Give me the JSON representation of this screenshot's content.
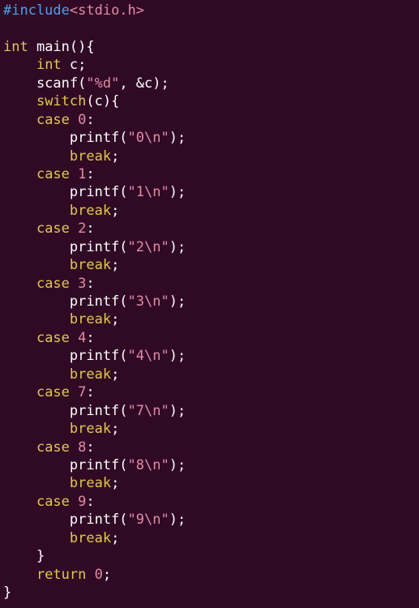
{
  "editor": {
    "background": "#300a24",
    "colors": {
      "preproc": "#4fa0e6",
      "type": "#dcca5a",
      "keyword": "#e2c84f",
      "string": "#e58aa8",
      "number": "#e58aa8",
      "default": "#ffffff"
    },
    "lines": [
      {
        "tokens": [
          {
            "text": "#include",
            "color": "#4fa0e6"
          },
          {
            "text": "<stdio.h>",
            "color": "#e58aa8"
          }
        ]
      },
      {
        "tokens": []
      },
      {
        "tokens": [
          {
            "text": "int",
            "color": "#dcca5a"
          },
          {
            "text": " main(){",
            "color": "#ffffff"
          }
        ]
      },
      {
        "tokens": [
          {
            "text": "    ",
            "color": "#ffffff"
          },
          {
            "text": "int",
            "color": "#dcca5a"
          },
          {
            "text": " c;",
            "color": "#ffffff"
          }
        ]
      },
      {
        "tokens": [
          {
            "text": "    scanf(",
            "color": "#ffffff"
          },
          {
            "text": "\"%d\"",
            "color": "#e58aa8"
          },
          {
            "text": ", &c);",
            "color": "#ffffff"
          }
        ]
      },
      {
        "tokens": [
          {
            "text": "    ",
            "color": "#ffffff"
          },
          {
            "text": "switch",
            "color": "#e2c84f"
          },
          {
            "text": "(c){",
            "color": "#ffffff"
          }
        ]
      },
      {
        "tokens": [
          {
            "text": "    ",
            "color": "#ffffff"
          },
          {
            "text": "case",
            "color": "#e2c84f"
          },
          {
            "text": " ",
            "color": "#ffffff"
          },
          {
            "text": "0",
            "color": "#e58aa8"
          },
          {
            "text": ":",
            "color": "#ffffff"
          }
        ]
      },
      {
        "tokens": [
          {
            "text": "        printf(",
            "color": "#ffffff"
          },
          {
            "text": "\"0\\n\"",
            "color": "#e58aa8"
          },
          {
            "text": ");",
            "color": "#ffffff"
          }
        ]
      },
      {
        "tokens": [
          {
            "text": "        ",
            "color": "#ffffff"
          },
          {
            "text": "break",
            "color": "#e2c84f"
          },
          {
            "text": ";",
            "color": "#ffffff"
          }
        ]
      },
      {
        "tokens": [
          {
            "text": "    ",
            "color": "#ffffff"
          },
          {
            "text": "case",
            "color": "#e2c84f"
          },
          {
            "text": " ",
            "color": "#ffffff"
          },
          {
            "text": "1",
            "color": "#e58aa8"
          },
          {
            "text": ":",
            "color": "#ffffff"
          }
        ]
      },
      {
        "tokens": [
          {
            "text": "        printf(",
            "color": "#ffffff"
          },
          {
            "text": "\"1\\n\"",
            "color": "#e58aa8"
          },
          {
            "text": ");",
            "color": "#ffffff"
          }
        ]
      },
      {
        "tokens": [
          {
            "text": "        ",
            "color": "#ffffff"
          },
          {
            "text": "break",
            "color": "#e2c84f"
          },
          {
            "text": ";",
            "color": "#ffffff"
          }
        ]
      },
      {
        "tokens": [
          {
            "text": "    ",
            "color": "#ffffff"
          },
          {
            "text": "case",
            "color": "#e2c84f"
          },
          {
            "text": " ",
            "color": "#ffffff"
          },
          {
            "text": "2",
            "color": "#e58aa8"
          },
          {
            "text": ":",
            "color": "#ffffff"
          }
        ]
      },
      {
        "tokens": [
          {
            "text": "        printf(",
            "color": "#ffffff"
          },
          {
            "text": "\"2\\n\"",
            "color": "#e58aa8"
          },
          {
            "text": ");",
            "color": "#ffffff"
          }
        ]
      },
      {
        "tokens": [
          {
            "text": "        ",
            "color": "#ffffff"
          },
          {
            "text": "break",
            "color": "#e2c84f"
          },
          {
            "text": ";",
            "color": "#ffffff"
          }
        ]
      },
      {
        "tokens": [
          {
            "text": "    ",
            "color": "#ffffff"
          },
          {
            "text": "case",
            "color": "#e2c84f"
          },
          {
            "text": " ",
            "color": "#ffffff"
          },
          {
            "text": "3",
            "color": "#e58aa8"
          },
          {
            "text": ":",
            "color": "#ffffff"
          }
        ]
      },
      {
        "tokens": [
          {
            "text": "        printf(",
            "color": "#ffffff"
          },
          {
            "text": "\"3\\n\"",
            "color": "#e58aa8"
          },
          {
            "text": ");",
            "color": "#ffffff"
          }
        ]
      },
      {
        "tokens": [
          {
            "text": "        ",
            "color": "#ffffff"
          },
          {
            "text": "break",
            "color": "#e2c84f"
          },
          {
            "text": ";",
            "color": "#ffffff"
          }
        ]
      },
      {
        "tokens": [
          {
            "text": "    ",
            "color": "#ffffff"
          },
          {
            "text": "case",
            "color": "#e2c84f"
          },
          {
            "text": " ",
            "color": "#ffffff"
          },
          {
            "text": "4",
            "color": "#e58aa8"
          },
          {
            "text": ":",
            "color": "#ffffff"
          }
        ]
      },
      {
        "tokens": [
          {
            "text": "        printf(",
            "color": "#ffffff"
          },
          {
            "text": "\"4\\n\"",
            "color": "#e58aa8"
          },
          {
            "text": ");",
            "color": "#ffffff"
          }
        ]
      },
      {
        "tokens": [
          {
            "text": "        ",
            "color": "#ffffff"
          },
          {
            "text": "break",
            "color": "#e2c84f"
          },
          {
            "text": ";",
            "color": "#ffffff"
          }
        ]
      },
      {
        "tokens": [
          {
            "text": "    ",
            "color": "#ffffff"
          },
          {
            "text": "case",
            "color": "#e2c84f"
          },
          {
            "text": " ",
            "color": "#ffffff"
          },
          {
            "text": "7",
            "color": "#e58aa8"
          },
          {
            "text": ":",
            "color": "#ffffff"
          }
        ]
      },
      {
        "tokens": [
          {
            "text": "        printf(",
            "color": "#ffffff"
          },
          {
            "text": "\"7\\n\"",
            "color": "#e58aa8"
          },
          {
            "text": ");",
            "color": "#ffffff"
          }
        ]
      },
      {
        "tokens": [
          {
            "text": "        ",
            "color": "#ffffff"
          },
          {
            "text": "break",
            "color": "#e2c84f"
          },
          {
            "text": ";",
            "color": "#ffffff"
          }
        ]
      },
      {
        "tokens": [
          {
            "text": "    ",
            "color": "#ffffff"
          },
          {
            "text": "case",
            "color": "#e2c84f"
          },
          {
            "text": " ",
            "color": "#ffffff"
          },
          {
            "text": "8",
            "color": "#e58aa8"
          },
          {
            "text": ":",
            "color": "#ffffff"
          }
        ]
      },
      {
        "tokens": [
          {
            "text": "        printf(",
            "color": "#ffffff"
          },
          {
            "text": "\"8\\n\"",
            "color": "#e58aa8"
          },
          {
            "text": ");",
            "color": "#ffffff"
          }
        ]
      },
      {
        "tokens": [
          {
            "text": "        ",
            "color": "#ffffff"
          },
          {
            "text": "break",
            "color": "#e2c84f"
          },
          {
            "text": ";",
            "color": "#ffffff"
          }
        ]
      },
      {
        "tokens": [
          {
            "text": "    ",
            "color": "#ffffff"
          },
          {
            "text": "case",
            "color": "#e2c84f"
          },
          {
            "text": " ",
            "color": "#ffffff"
          },
          {
            "text": "9",
            "color": "#e58aa8"
          },
          {
            "text": ":",
            "color": "#ffffff"
          }
        ]
      },
      {
        "tokens": [
          {
            "text": "        printf(",
            "color": "#ffffff"
          },
          {
            "text": "\"9\\n\"",
            "color": "#e58aa8"
          },
          {
            "text": ");",
            "color": "#ffffff"
          }
        ]
      },
      {
        "tokens": [
          {
            "text": "        ",
            "color": "#ffffff"
          },
          {
            "text": "break",
            "color": "#e2c84f"
          },
          {
            "text": ";",
            "color": "#ffffff"
          }
        ]
      },
      {
        "tokens": [
          {
            "text": "    }",
            "color": "#ffffff"
          }
        ]
      },
      {
        "tokens": [
          {
            "text": "    ",
            "color": "#ffffff"
          },
          {
            "text": "return",
            "color": "#e2c84f"
          },
          {
            "text": " ",
            "color": "#ffffff"
          },
          {
            "text": "0",
            "color": "#e58aa8"
          },
          {
            "text": ";",
            "color": "#ffffff"
          }
        ]
      },
      {
        "tokens": [
          {
            "text": "}",
            "color": "#ffffff"
          }
        ]
      }
    ]
  }
}
